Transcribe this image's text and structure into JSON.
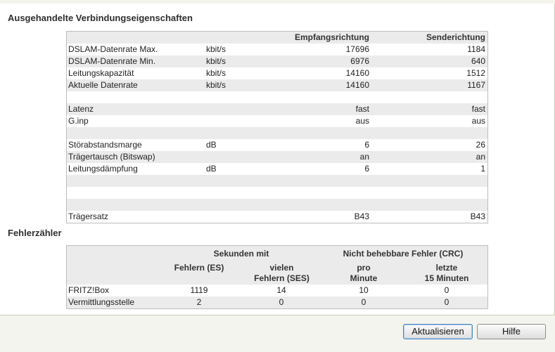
{
  "sections": {
    "connection_title": "Ausgehandelte Verbindungseigenschaften",
    "errors_title": "Fehlerzähler"
  },
  "connection": {
    "headers": {
      "down": "Empfangsrichtung",
      "up": "Senderichtung"
    },
    "rows": [
      {
        "label": "DSLAM-Datenrate Max.",
        "unit": "kbit/s",
        "down": "17696",
        "up": "1184"
      },
      {
        "label": "DSLAM-Datenrate Min.",
        "unit": "kbit/s",
        "down": "6976",
        "up": "640"
      },
      {
        "label": "Leitungskapazität",
        "unit": "kbit/s",
        "down": "14160",
        "up": "1512"
      },
      {
        "label": "Aktuelle Datenrate",
        "unit": "kbit/s",
        "down": "14160",
        "up": "1167"
      },
      {
        "label": "",
        "unit": "",
        "down": "",
        "up": ""
      },
      {
        "label": "Latenz",
        "unit": "",
        "down": "fast",
        "up": "fast"
      },
      {
        "label": "G.inp",
        "unit": "",
        "down": "aus",
        "up": "aus"
      },
      {
        "label": "",
        "unit": "",
        "down": "",
        "up": ""
      },
      {
        "label": "Störabstandsmarge",
        "unit": "dB",
        "down": "6",
        "up": "26"
      },
      {
        "label": "Trägertausch (Bitswap)",
        "unit": "",
        "down": "an",
        "up": "an"
      },
      {
        "label": "Leitungsdämpfung",
        "unit": "dB",
        "down": "6",
        "up": "1"
      },
      {
        "label": "",
        "unit": "",
        "down": "",
        "up": ""
      },
      {
        "label": "",
        "unit": "",
        "down": "",
        "up": ""
      },
      {
        "label": "",
        "unit": "",
        "down": "",
        "up": ""
      },
      {
        "label": "Trägersatz",
        "unit": "",
        "down": "B43",
        "up": "B43"
      }
    ]
  },
  "errors": {
    "group_seconds": "Sekunden mit",
    "group_crc": "Nicht behebbare Fehler (CRC)",
    "col_es": "Fehlern (ES)",
    "col_ses_1": "vielen",
    "col_ses_2": "Fehlern (SES)",
    "col_min_1": "pro",
    "col_min_2": "Minute",
    "col_15_1": "letzte",
    "col_15_2": "15 Minuten",
    "rows": [
      {
        "label": "FRITZ!Box",
        "es": "1119",
        "ses": "14",
        "per_min": "10",
        "last15": "0"
      },
      {
        "label": "Vermittlungsstelle",
        "es": "2",
        "ses": "0",
        "per_min": "0",
        "last15": "0"
      }
    ]
  },
  "buttons": {
    "refresh": "Aktualisieren",
    "help": "Hilfe"
  }
}
